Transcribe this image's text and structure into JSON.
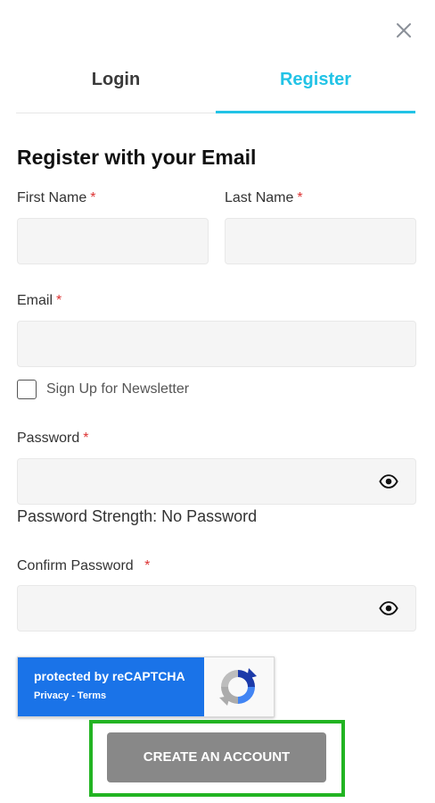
{
  "tabs": {
    "login": "Login",
    "register": "Register"
  },
  "form": {
    "heading": "Register with your Email",
    "required_marker": "*",
    "first_name": {
      "label": "First Name",
      "value": ""
    },
    "last_name": {
      "label": "Last Name",
      "value": ""
    },
    "email": {
      "label": "Email",
      "value": ""
    },
    "newsletter": {
      "label": "Sign Up for Newsletter",
      "checked": false
    },
    "password": {
      "label": "Password",
      "value": ""
    },
    "password_strength": "Password Strength: No Password",
    "confirm_password": {
      "label": "Confirm Password",
      "value": ""
    }
  },
  "recaptcha": {
    "title": "protected by reCAPTCHA",
    "links": "Privacy - Terms"
  },
  "submit_label": "CREATE AN ACCOUNT",
  "colors": {
    "accent": "#22c3e6",
    "button": "#888888",
    "highlight": "#22b422",
    "recaptcha_blue": "#1a73e8",
    "required": "#d33333"
  },
  "icons": {
    "close": "close-icon",
    "eye": "eye-icon",
    "recaptcha": "recaptcha-logo-icon"
  }
}
